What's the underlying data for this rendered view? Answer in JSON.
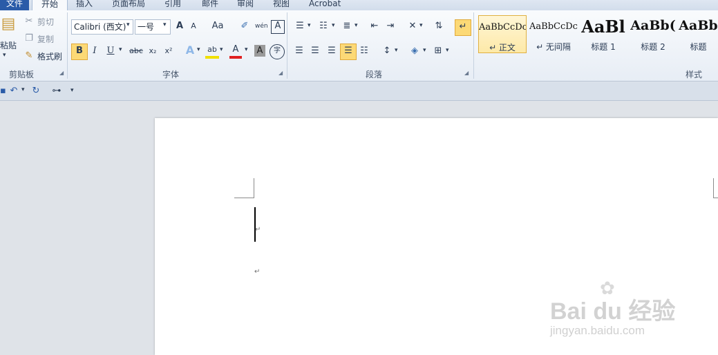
{
  "tabs": {
    "file": "文件",
    "home": "开始",
    "insert": "插入",
    "layout": "页面布局",
    "references": "引用",
    "mailings": "邮件",
    "review": "审阅",
    "view": "视图",
    "acrobat": "Acrobat"
  },
  "clipboard": {
    "paste": "粘贴",
    "cut": "剪切",
    "copy": "复制",
    "format_painter": "格式刷",
    "group": "剪贴板"
  },
  "font": {
    "name": "Calibri (西文)",
    "size": "一号",
    "group": "字体",
    "grow_icon": "A",
    "shrink_icon": "A",
    "case_label": "Aa",
    "phonetic_label": "wén",
    "border_char_label": "A",
    "bold": "B",
    "italic": "I",
    "underline": "U",
    "strike": "abc",
    "subscript": "x₂",
    "superscript": "x²",
    "effects": "A",
    "highlight": "ab",
    "color": "A",
    "shading": "A",
    "enclose": "字"
  },
  "paragraph": {
    "group": "段落"
  },
  "styles": {
    "group": "样式",
    "items": [
      {
        "sample": "AaBbCcDc",
        "name": "↵ 正文"
      },
      {
        "sample": "AaBbCcDc",
        "name": "↵ 无间隔"
      },
      {
        "sample": "AaBl",
        "name": "标题 1"
      },
      {
        "sample": "AaBb(",
        "name": "标题 2"
      },
      {
        "sample": "AaBb",
        "name": "标题"
      }
    ]
  },
  "document": {
    "paragraph_mark": "↵"
  },
  "watermark": {
    "brand": "Bai du 经验",
    "url": "jingyan.baidu.com"
  },
  "colors": {
    "file_tab": "#2a5ba8",
    "highlight_yellow": "#fcd976",
    "font_red": "#e02020"
  }
}
